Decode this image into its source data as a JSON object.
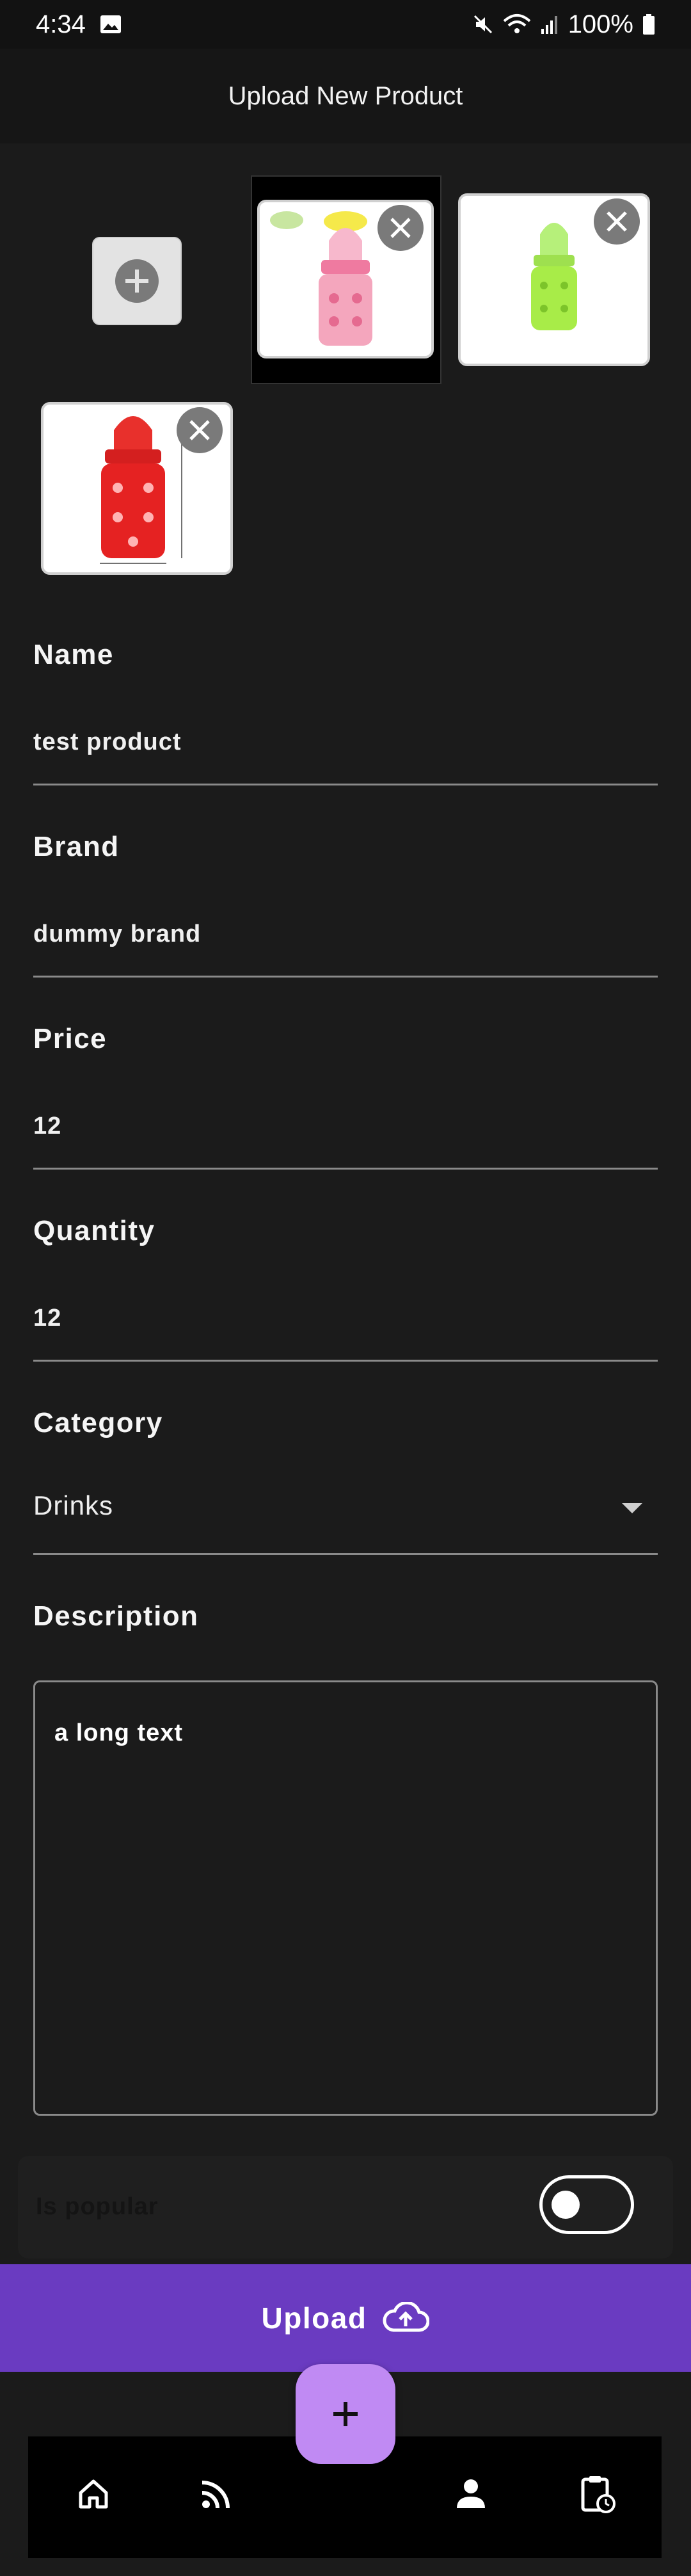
{
  "status_bar": {
    "time": "4:34",
    "battery": "100%"
  },
  "app_bar": {
    "title": "Upload New Product"
  },
  "images": {
    "thumbnails": [
      {
        "label": "pink-bottle"
      },
      {
        "label": "green-bottle"
      },
      {
        "label": "red-bottle"
      }
    ]
  },
  "form": {
    "name": {
      "label": "Name",
      "value": "test product"
    },
    "brand": {
      "label": "Brand",
      "value": "dummy brand"
    },
    "price": {
      "label": "Price",
      "value": "12"
    },
    "quantity": {
      "label": "Quantity",
      "value": "12"
    },
    "category": {
      "label": "Category",
      "value": "Drinks"
    },
    "description": {
      "label": "Description",
      "value": "a long text"
    },
    "popular": {
      "label": "Is popular",
      "enabled": false
    }
  },
  "upload": {
    "label": "Upload"
  },
  "nav": {
    "items": [
      {
        "icon": "home-icon"
      },
      {
        "icon": "feed-icon"
      },
      {
        "icon": "person-icon"
      },
      {
        "icon": "clipboard-clock-icon"
      }
    ]
  },
  "colors": {
    "background": "#1b1b1b",
    "upload_button": "#6a3bc1",
    "fab": "#c08af3"
  }
}
